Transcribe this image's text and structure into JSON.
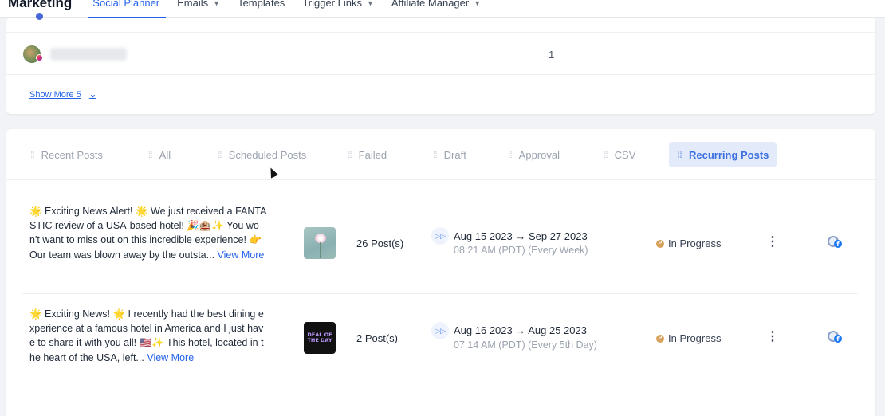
{
  "nav": {
    "brand": "Marketing",
    "items": [
      {
        "label": "Social Planner",
        "active": true,
        "has_caret": false
      },
      {
        "label": "Emails",
        "active": false,
        "has_caret": true
      },
      {
        "label": "Templates",
        "active": false,
        "has_caret": false
      },
      {
        "label": "Trigger Links",
        "active": false,
        "has_caret": true
      },
      {
        "label": "Affiliate Manager",
        "active": false,
        "has_caret": true
      }
    ]
  },
  "accounts": {
    "row": {
      "name": "rudinabrand05",
      "count": "1"
    },
    "show_more": "Show More 5"
  },
  "tabs": [
    {
      "label": "Recent Posts",
      "active": false
    },
    {
      "label": "All",
      "active": false
    },
    {
      "label": "Scheduled Posts",
      "active": false
    },
    {
      "label": "Failed",
      "active": false
    },
    {
      "label": "Draft",
      "active": false
    },
    {
      "label": "Approval",
      "active": false
    },
    {
      "label": "CSV",
      "active": false
    },
    {
      "label": "Recurring Posts",
      "active": true
    }
  ],
  "posts": [
    {
      "text": "🌟 Exciting News Alert! 🌟 We just received a FANTASTIC review of a USA-based hotel! 🎉🏨✨ You won't want to miss out on this incredible experience! 👉 Our team was blown away by the outsta...",
      "view_more": "View More",
      "count": "26 Post(s)",
      "date_range": "Aug 15 2023  →  Sep 27 2023",
      "time": "08:21 AM (PDT) (Every Week)",
      "status": "In Progress",
      "thumbnail": "pink-flower-image"
    },
    {
      "text": "🌟 Exciting News! 🌟 I recently had the best dining experience at a famous hotel in America and I just have to share it with you all! 🇺🇸✨ This hotel, located in the heart of the USA, left...",
      "view_more": "View More",
      "count": "2 Post(s)",
      "date_range": "Aug 16 2023  →  Aug 25 2023",
      "time": "07:14 AM (PDT) (Every 5th Day)",
      "status": "In Progress",
      "thumbnail": "deal-of-the-day-image",
      "thumbnail_text": "DEAL OF THE DAY"
    }
  ],
  "icons": {
    "recurring": "fast-forward-icon",
    "status": "status-p-icon",
    "menu": "kebab-menu-icon",
    "channel": "facebook-icon"
  },
  "colors": {
    "accent": "#2563eb",
    "active_tab_bg": "#e3ebfb",
    "status_dot": "#d6a15a"
  }
}
